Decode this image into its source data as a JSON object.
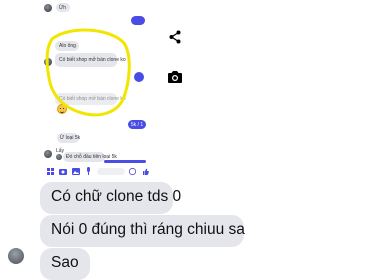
{
  "chat": {
    "small_messages": {
      "top_sender": "Ừh",
      "highlighted_line1": "Alo ông",
      "highlighted_line2": "Có biết shop mở bán clone ko",
      "blurred_line1": "",
      "blurred_line2": "Có biết shop mở bán clone ko",
      "short_reply": "Ừ loại 5k",
      "lay_label": "Lấy",
      "shop_reply": "Đó chỗ đầu tiên loại 5k",
      "blue_badge": "5k / 1"
    },
    "messages": [
      {
        "text": "Có chữ clone tds 0"
      },
      {
        "text": "Nói 0 đúng thì ráng chiuu sa"
      },
      {
        "text": "Sao"
      }
    ]
  },
  "icons": {
    "share": "share-icon",
    "camera": "camera-icon"
  },
  "colors": {
    "accent": "#4a4ce6",
    "highlight": "#f2e600",
    "bubble": "#e4e6eb"
  }
}
